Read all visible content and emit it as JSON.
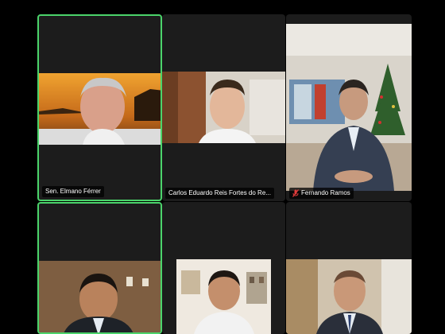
{
  "participants": [
    {
      "name": "Sen. Elmano Férrer",
      "active": true,
      "muted": false
    },
    {
      "name": "Carlos Eduardo Reis Fortes do Re...",
      "active": false,
      "muted": false
    },
    {
      "name": "Fernando Ramos",
      "active": false,
      "muted": true
    },
    {
      "name": "",
      "active": true,
      "muted": false
    },
    {
      "name": "",
      "active": false,
      "muted": false
    },
    {
      "name": "",
      "active": false,
      "muted": false
    }
  ],
  "colors": {
    "active_border": "#4bd46b",
    "muted_icon": "#e03b3b",
    "tile_bg": "#1c1c1c"
  },
  "icons": [
    "mic-muted-icon"
  ]
}
